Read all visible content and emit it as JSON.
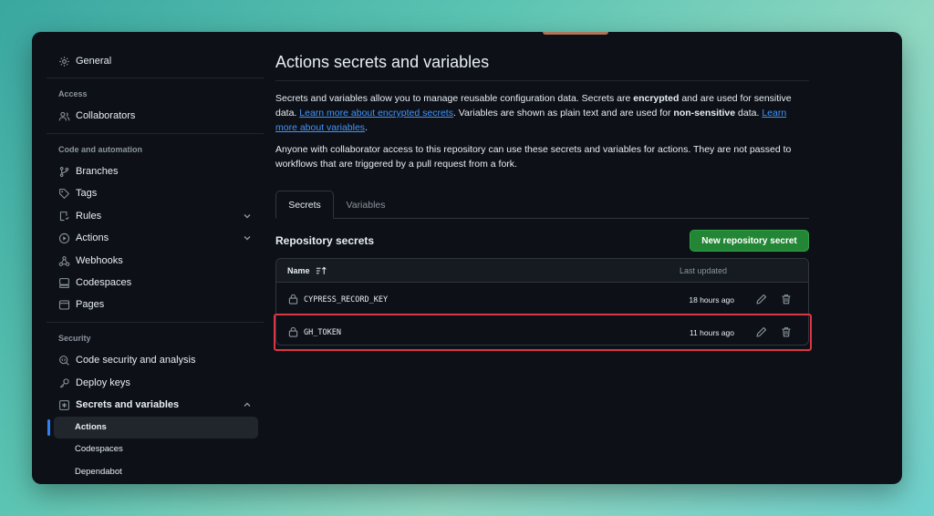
{
  "sidebar": {
    "general": "General",
    "sections": {
      "access": "Access",
      "code_automation": "Code and automation",
      "security": "Security"
    },
    "items": {
      "collaborators": "Collaborators",
      "branches": "Branches",
      "tags": "Tags",
      "rules": "Rules",
      "actions": "Actions",
      "webhooks": "Webhooks",
      "codespaces": "Codespaces",
      "pages": "Pages",
      "code_security": "Code security and analysis",
      "deploy_keys": "Deploy keys",
      "secrets_variables": "Secrets and variables"
    },
    "sub_items": {
      "actions": "Actions",
      "codespaces": "Codespaces",
      "dependabot": "Dependabot"
    }
  },
  "main": {
    "title": "Actions secrets and variables",
    "desc1": {
      "p1": "Secrets and variables allow you to manage reusable configuration data. Secrets are ",
      "b1": "encrypted",
      "p2": " and are used for sensitive data. ",
      "link1": "Learn more about encrypted secrets",
      "p3": ". Variables are shown as plain text and are used for ",
      "b2": "non-sensitive",
      "p4": " data. ",
      "link2": "Learn more about variables",
      "p5": "."
    },
    "desc2": "Anyone with collaborator access to this repository can use these secrets and variables for actions. They are not passed to workflows that are triggered by a pull request from a fork.",
    "tabs": [
      "Secrets",
      "Variables"
    ],
    "repo_secrets_heading": "Repository secrets",
    "new_secret_button": "New repository secret",
    "table": {
      "col_name": "Name",
      "col_updated": "Last updated",
      "rows": [
        {
          "name": "CYPRESS_RECORD_KEY",
          "updated": "18 hours ago"
        },
        {
          "name": "GH_TOKEN",
          "updated": "11 hours ago"
        }
      ]
    }
  },
  "colors": {
    "accent_link": "#4493f8",
    "button_green": "#238636",
    "highlight_red": "#da3645",
    "active_nav": "#2f81f7"
  }
}
